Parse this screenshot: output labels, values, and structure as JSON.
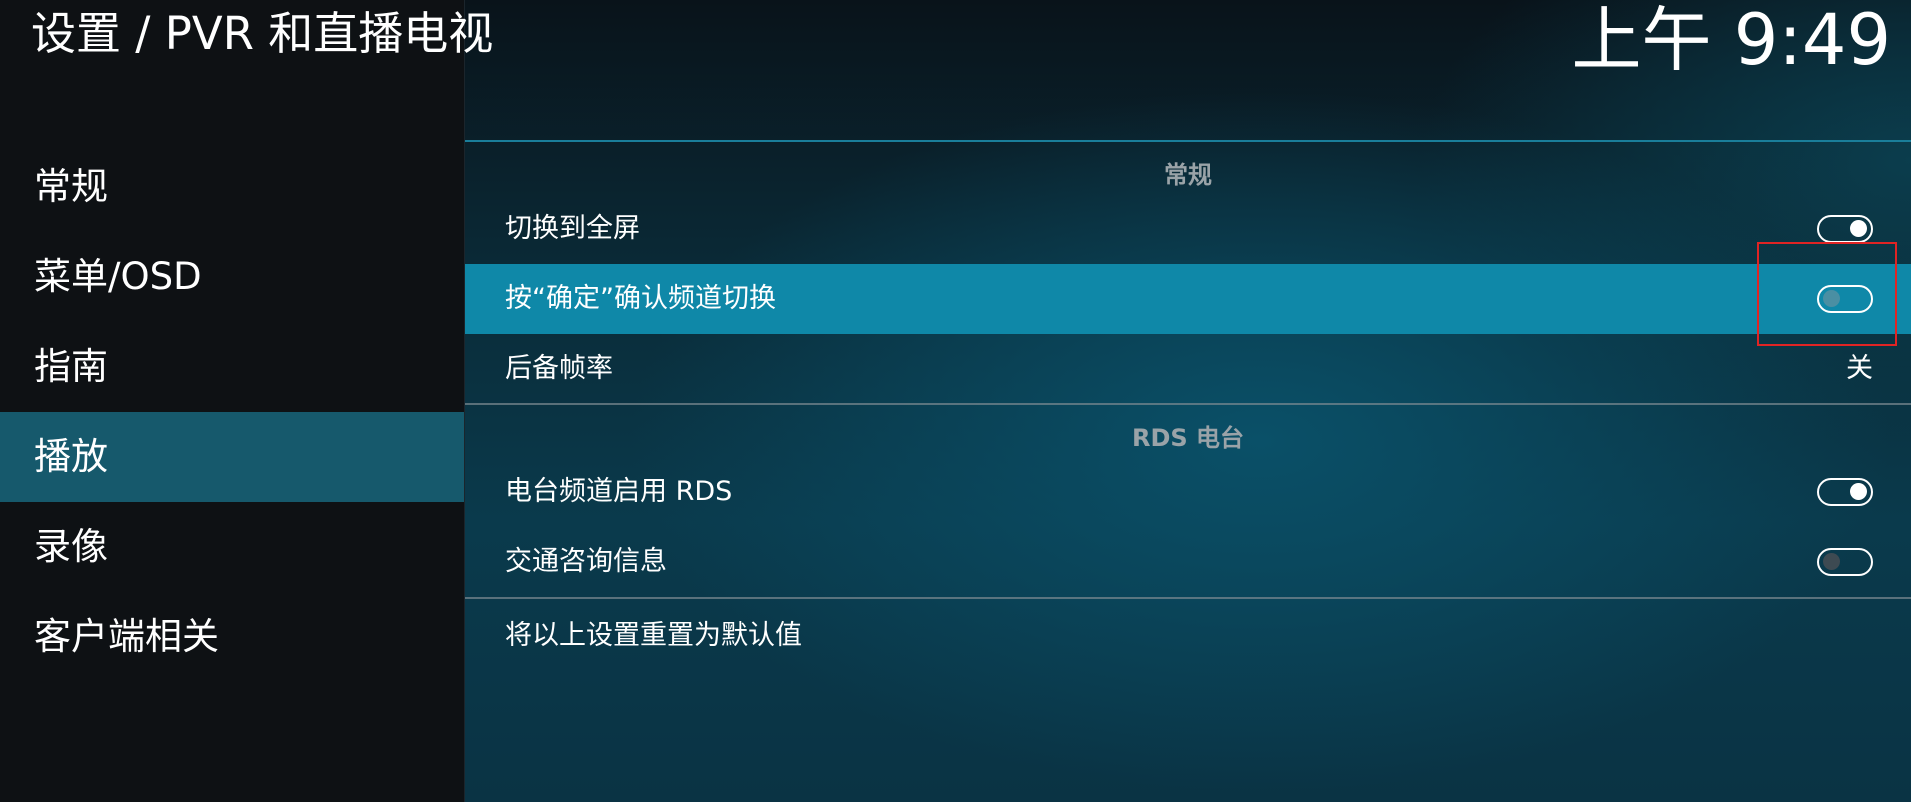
{
  "header": {
    "title": "设置 / PVR 和直播电视",
    "clock": "上午 9:49"
  },
  "sidebar": {
    "items": [
      {
        "label": "常规",
        "active": false
      },
      {
        "label": "菜单/OSD",
        "active": false
      },
      {
        "label": "指南",
        "active": false
      },
      {
        "label": "播放",
        "active": true
      },
      {
        "label": "录像",
        "active": false
      },
      {
        "label": "客户端相关",
        "active": false
      }
    ]
  },
  "main": {
    "sections": [
      {
        "title": "常规",
        "rows": [
          {
            "label": "切换到全屏",
            "control": "toggle",
            "state": "on"
          },
          {
            "label": "按“确定”确认频道切换",
            "control": "toggle",
            "state": "off",
            "focused": true
          },
          {
            "label": "后备帧率",
            "control": "value",
            "value": "关"
          }
        ]
      },
      {
        "title": "RDS 电台",
        "rows": [
          {
            "label": "电台频道启用 RDS",
            "control": "toggle",
            "state": "on"
          },
          {
            "label": "交通咨询信息",
            "control": "toggle",
            "state": "off"
          }
        ]
      }
    ],
    "reset_label": "将以上设置重置为默认值"
  },
  "colors": {
    "accent": "#0f88a8",
    "sidebar_active": "#16596c",
    "highlight_box": "#e02424"
  }
}
